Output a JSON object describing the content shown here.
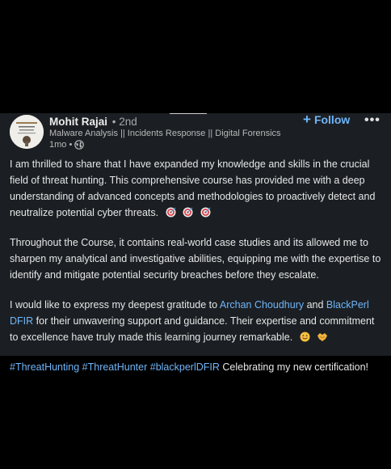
{
  "author": {
    "name": "Mohit Rajai",
    "degree": "• 2nd",
    "headline": "Malware Analysis || Incidents Response || Digital Forensics",
    "time": "1mo •"
  },
  "actions": {
    "follow_label": "Follow",
    "more_label": "•••"
  },
  "paragraphs": {
    "p1": "I am thrilled to share that I have expanded my knowledge and skills in the crucial field of threat hunting. This comprehensive course has provided me with a deep understanding of advanced concepts and methodologies to proactively detect and neutralize potential cyber threats.",
    "p2": "Throughout the Course, it contains real-world case studies and its allowed me to sharpen my analytical and investigative abilities, equipping me with the expertise to identify and mitigate potential security breaches before they escalate.",
    "p3_start": "I would like to express my deepest gratitude to ",
    "p3_link1": "Archan Choudhury",
    "p3_and": " and ",
    "p3_link2": "BlackPerl DFIR",
    "p3_end": " for their unwavering support and guidance. Their expertise and commitment to excellence have truly made this learning journey remarkable.",
    "hashtag1": "#ThreatHunting",
    "hashtag2": "#ThreatHunter",
    "hashtag3": "#blackperlDFIR",
    "p4_end": " Celebrating my new certification!"
  },
  "colors": {
    "background": "#000000",
    "card": "#1b1f23",
    "link": "#70b5f9",
    "text": "#e6e6e6"
  },
  "icons": [
    "globe-icon",
    "target-icon",
    "smile-emoji-icon",
    "handshake-emoji-icon",
    "plus-icon",
    "more-icon"
  ]
}
